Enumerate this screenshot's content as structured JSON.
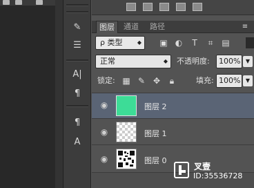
{
  "tabs": [
    {
      "label": "图层",
      "active": true
    },
    {
      "label": "通道",
      "active": false
    },
    {
      "label": "路径",
      "active": false
    }
  ],
  "filter": {
    "kind_label": "ρ 类型"
  },
  "blend": {
    "mode": "正常",
    "opacity_label": "不透明度:",
    "opacity_value": "100%"
  },
  "lock": {
    "label": "锁定:",
    "fill_label": "填充:",
    "fill_value": "100%"
  },
  "layers": [
    {
      "name": "图层 2",
      "selected": true,
      "fill_color": "#3ddc97"
    },
    {
      "name": "图层 1",
      "selected": false
    },
    {
      "name": "图层 0",
      "selected": false
    }
  ],
  "watermark": {
    "brand": "叉壹",
    "id": "ID:35536728"
  },
  "colors": {
    "selected_row": "#5a6475",
    "accent_green": "#3ddc97"
  },
  "icons": [
    "eye-icon",
    "lock-icon",
    "brush-icon",
    "move-icon",
    "chevron-down-icon",
    "panel-menu-icon"
  ]
}
